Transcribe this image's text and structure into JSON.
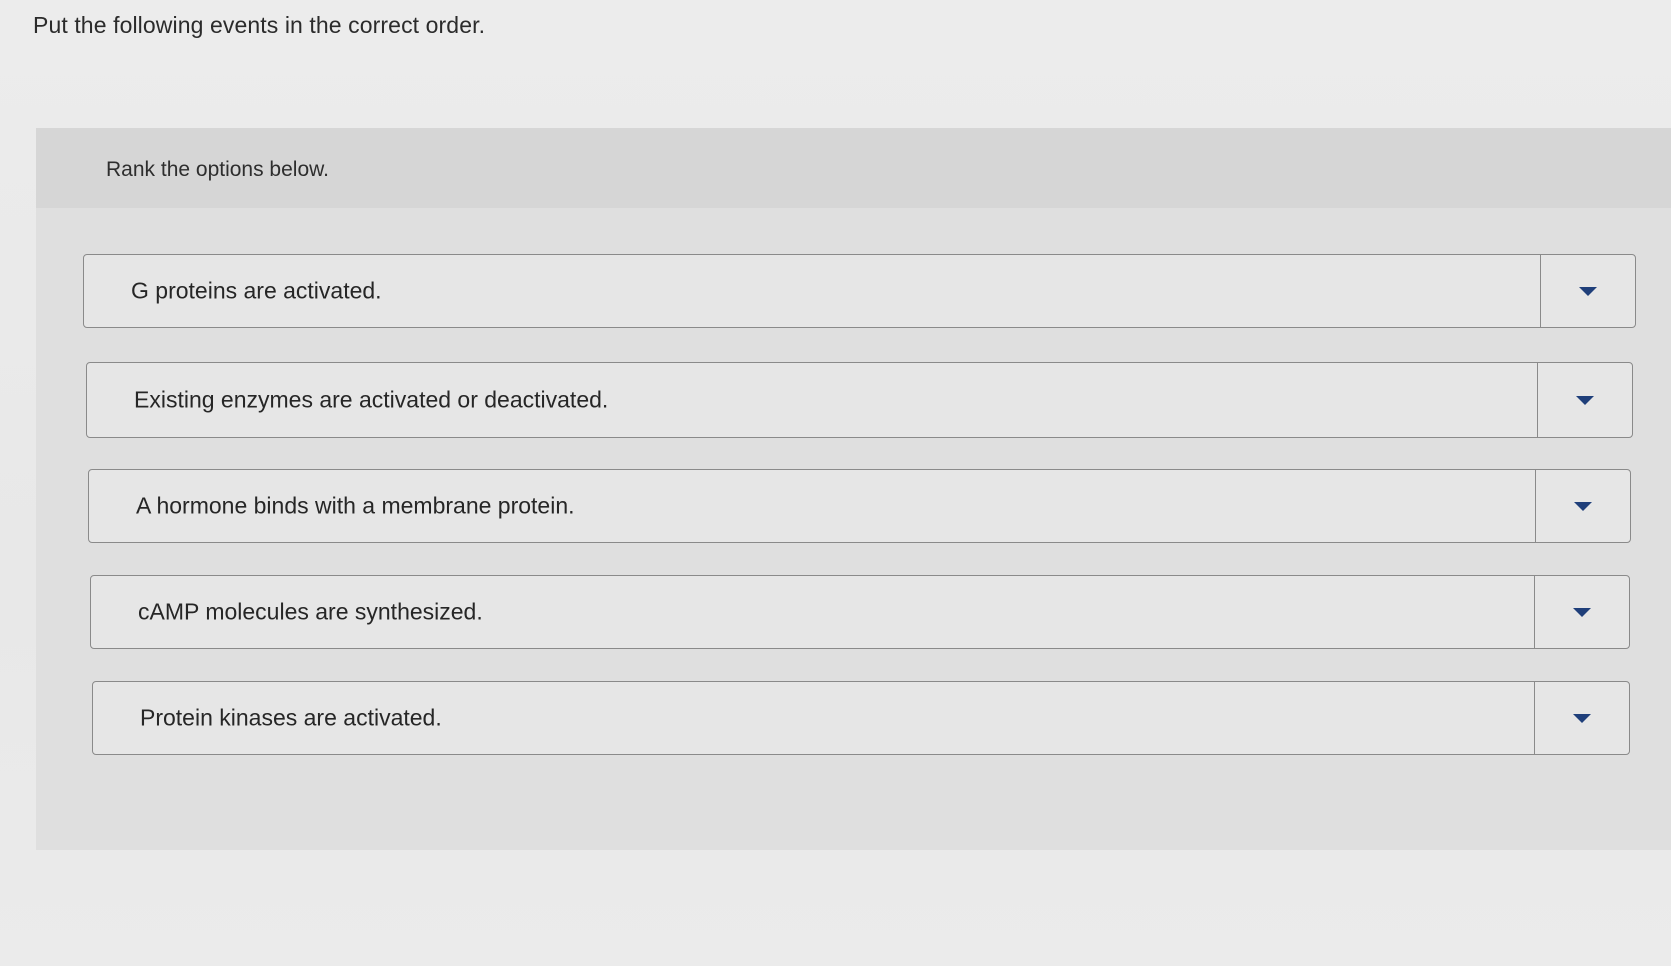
{
  "question": {
    "title": "Put the following events in the correct order."
  },
  "panel": {
    "instruction": "Rank the options below."
  },
  "rank_items": [
    {
      "label": "G proteins are activated.",
      "dropdown_icon": "caret-down-icon"
    },
    {
      "label": "Existing enzymes are activated or deactivated.",
      "dropdown_icon": "caret-down-icon"
    },
    {
      "label": "A hormone binds with a membrane protein.",
      "dropdown_icon": "caret-down-icon"
    },
    {
      "label": "cAMP molecules are synthesized.",
      "dropdown_icon": "caret-down-icon"
    },
    {
      "label": "Protein kinases are activated.",
      "dropdown_icon": "caret-down-icon"
    }
  ],
  "colors": {
    "accent_caret": "#1f3f7a",
    "panel_background": "#dfdfdf",
    "border": "#8a8a8a"
  }
}
